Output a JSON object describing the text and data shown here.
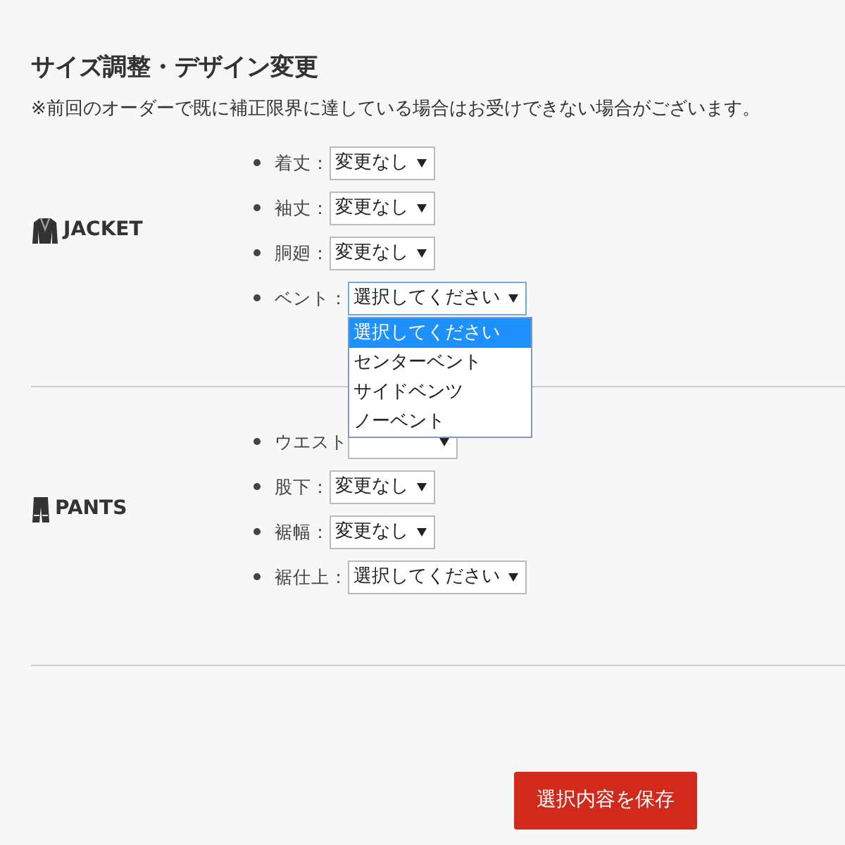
{
  "title": "サイズ調整・デザイン変更",
  "note": "※前回のオーダーで既に補正限界に達している場合はお受けできない場合がございます。",
  "sections": [
    {
      "kind": "jacket",
      "label": "JACKET",
      "fields": [
        {
          "label": "着丈：",
          "value": "変更なし",
          "expanded": false
        },
        {
          "label": "袖丈：",
          "value": "変更なし",
          "expanded": false
        },
        {
          "label": "胴廻：",
          "value": "変更なし",
          "expanded": false
        },
        {
          "label": "ベント：",
          "value": "選択してください",
          "expanded": true,
          "options": [
            {
              "label": "選択してください",
              "selected": true
            },
            {
              "label": "センターベント",
              "selected": false
            },
            {
              "label": "サイドベンツ",
              "selected": false
            },
            {
              "label": "ノーベント",
              "selected": false
            }
          ]
        }
      ]
    },
    {
      "kind": "pants",
      "label": "PANTS",
      "fields": [
        {
          "label": "ウエスト",
          "expanded": false
        },
        {
          "label": "股下：",
          "value": "変更なし",
          "expanded": false
        },
        {
          "label": "裾幅：",
          "value": "変更なし",
          "expanded": false
        },
        {
          "label": "裾仕上：",
          "value": "選択してください",
          "expanded": false
        }
      ]
    }
  ],
  "save_button": "選択内容を保存"
}
